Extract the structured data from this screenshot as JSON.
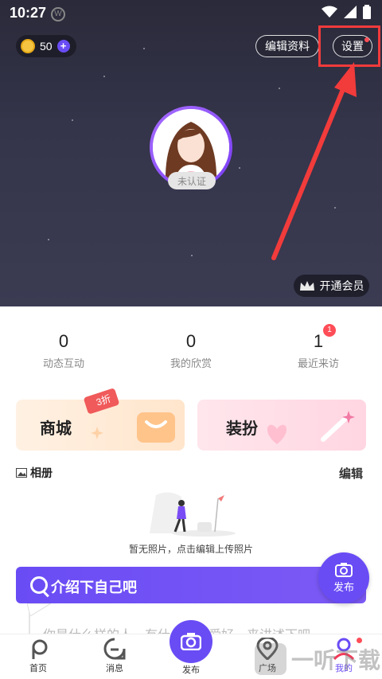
{
  "status_bar": {
    "time": "10:27",
    "notif_glyph": "W"
  },
  "header": {
    "coin_count": "50",
    "edit_profile_label": "编辑资料",
    "settings_label": "设置",
    "verify_label": "未认证",
    "vip_label": "开通会员"
  },
  "stats": [
    {
      "value": "0",
      "label": "动态互动"
    },
    {
      "value": "0",
      "label": "我的欣赏"
    },
    {
      "value": "1",
      "label": "最近来访",
      "badge": "1"
    }
  ],
  "cards": {
    "shop_label": "商城",
    "shop_discount": "3折",
    "dress_label": "装扮"
  },
  "album": {
    "title": "相册",
    "edit_label": "编辑",
    "empty_text": "暂无照片，点击编辑上传照片"
  },
  "intro": {
    "title": "介绍下自己吧",
    "preview_text": "你是什么样的人，有什么兴趣爱好，来讲述下吧"
  },
  "fab": {
    "label": "发布"
  },
  "tabs": [
    {
      "label": "首页"
    },
    {
      "label": "消息"
    },
    {
      "label": "发布"
    },
    {
      "label": "广场"
    },
    {
      "label": "我的"
    }
  ],
  "colors": {
    "accent": "#6a4cf5",
    "alert": "#f23b3b"
  },
  "watermark": "一听下载"
}
